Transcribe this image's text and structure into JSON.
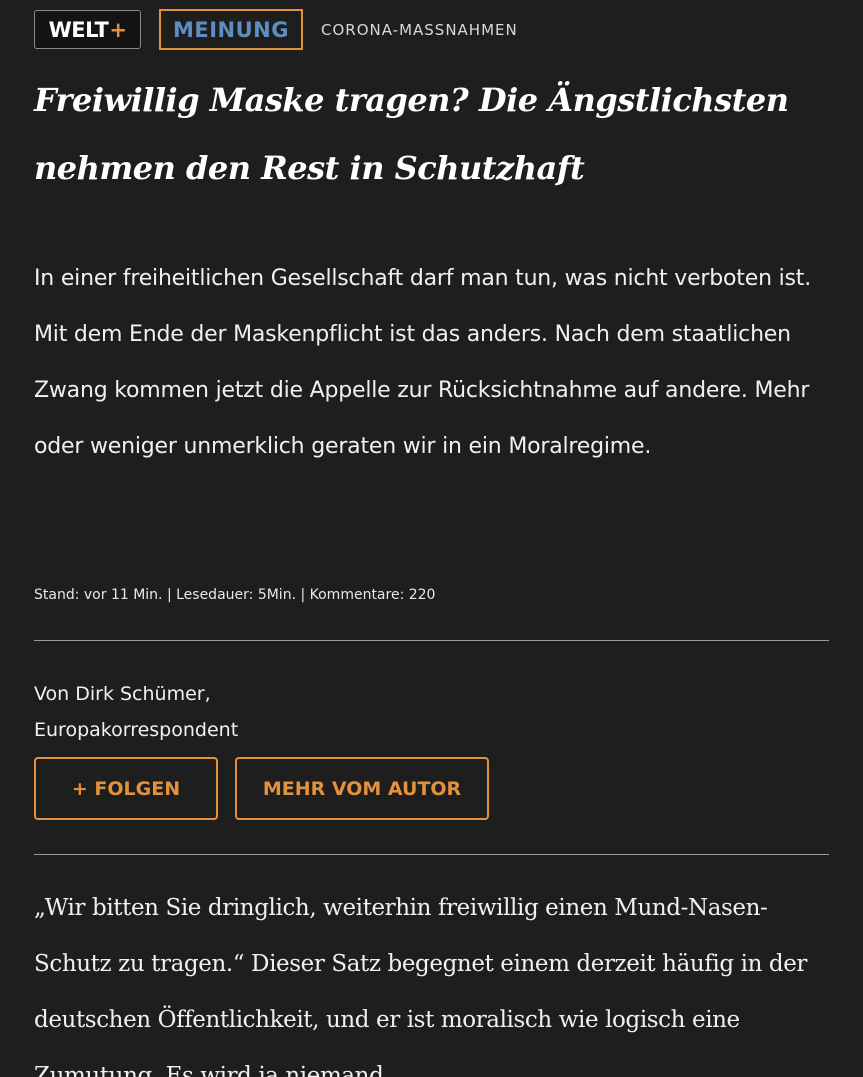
{
  "header": {
    "logo_text": "WELT",
    "logo_plus": "+",
    "badge": "MEINUNG",
    "kicker": "CORONA-MASSNAHMEN"
  },
  "article": {
    "headline": "Freiwillig Maske tragen? Die Ängstlichsten nehmen den Rest in Schutzhaft",
    "intro": "In einer freiheitlichen Gesellschaft darf man tun, was nicht verboten ist. Mit dem Ende der Maskenpflicht ist das anders. Nach dem staatlichen Zwang kommen jetzt die Appelle zur Rücksichtnahme auf andere. Mehr oder weniger unmerklich geraten wir in ein Moralregime.",
    "meta": "Stand: vor 11 Min. | Lesedauer: 5Min. | Kommentare: 220",
    "author_line1": "Von Dirk Schümer,",
    "author_line2": "Europakorrespondent",
    "body": "„Wir bitten Sie dringlich, weiterhin freiwillig einen Mund-Nasen-Schutz zu tragen.“ Dieser Satz begegnet einem derzeit häufig in der deutschen Öffentlichkeit, und er ist moralisch wie logisch eine Zumutung. Es wird ja niemand"
  },
  "buttons": {
    "follow": "+ FOLGEN",
    "more_from_author": "MEHR VOM AUTOR"
  },
  "colors": {
    "background": "#1e1e1e",
    "accent": "#e2913d",
    "badge_text": "#5e8dc1"
  }
}
